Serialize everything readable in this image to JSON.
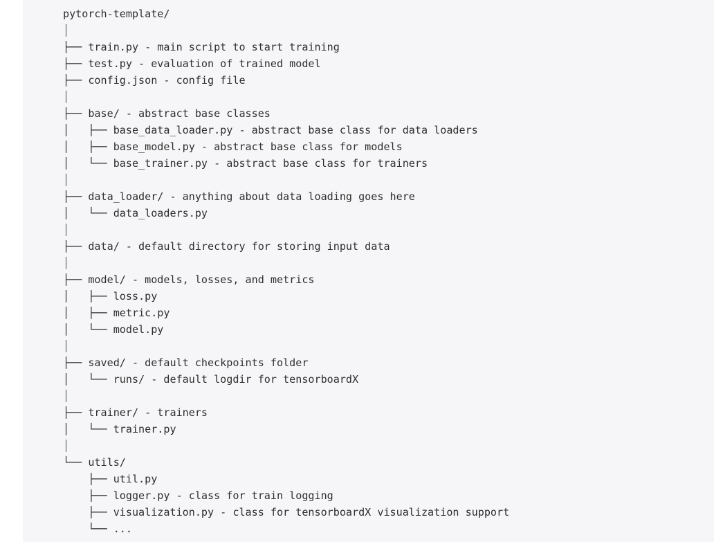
{
  "document": {
    "kind": "directory-tree-listing",
    "root_label": "pytorch-template/",
    "colors": {
      "page_background": "#ffffff",
      "content_background": "#f6f6f8",
      "text": "#2e2e2e",
      "tree_rule": "#5a6a65"
    },
    "lines": [
      "pytorch-template/",
      "│",
      "├── train.py - main script to start training",
      "├── test.py - evaluation of trained model",
      "├── config.json - config file",
      "│",
      "├── base/ - abstract base classes",
      "│   ├── base_data_loader.py - abstract base class for data loaders",
      "│   ├── base_model.py - abstract base class for models",
      "│   └── base_trainer.py - abstract base class for trainers",
      "│",
      "├── data_loader/ - anything about data loading goes here",
      "│   └── data_loaders.py",
      "│",
      "├── data/ - default directory for storing input data",
      "│",
      "├── model/ - models, losses, and metrics",
      "│   ├── loss.py",
      "│   ├── metric.py",
      "│   └── model.py",
      "│",
      "├── saved/ - default checkpoints folder",
      "│   └── runs/ - default logdir for tensorboardX",
      "│",
      "├── trainer/ - trainers",
      "│   └── trainer.py",
      "│",
      "└── utils/",
      "    ├── util.py",
      "    ├── logger.py - class for train logging",
      "    ├── visualization.py - class for tensorboardX visualization support",
      "    └── ..."
    ],
    "entries": [
      {
        "name": "pytorch-template/",
        "type": "directory",
        "depth": 0,
        "description": ""
      },
      {
        "name": "train.py",
        "type": "file",
        "depth": 1,
        "description": "main script to start training"
      },
      {
        "name": "test.py",
        "type": "file",
        "depth": 1,
        "description": "evaluation of trained model"
      },
      {
        "name": "config.json",
        "type": "file",
        "depth": 1,
        "description": "config file"
      },
      {
        "name": "base/",
        "type": "directory",
        "depth": 1,
        "description": "abstract base classes"
      },
      {
        "name": "base_data_loader.py",
        "type": "file",
        "depth": 2,
        "description": "abstract base class for data loaders"
      },
      {
        "name": "base_model.py",
        "type": "file",
        "depth": 2,
        "description": "abstract base class for models"
      },
      {
        "name": "base_trainer.py",
        "type": "file",
        "depth": 2,
        "description": "abstract base class for trainers"
      },
      {
        "name": "data_loader/",
        "type": "directory",
        "depth": 1,
        "description": "anything about data loading goes here"
      },
      {
        "name": "data_loaders.py",
        "type": "file",
        "depth": 2,
        "description": ""
      },
      {
        "name": "data/",
        "type": "directory",
        "depth": 1,
        "description": "default directory for storing input data"
      },
      {
        "name": "model/",
        "type": "directory",
        "depth": 1,
        "description": "models, losses, and metrics"
      },
      {
        "name": "loss.py",
        "type": "file",
        "depth": 2,
        "description": ""
      },
      {
        "name": "metric.py",
        "type": "file",
        "depth": 2,
        "description": ""
      },
      {
        "name": "model.py",
        "type": "file",
        "depth": 2,
        "description": ""
      },
      {
        "name": "saved/",
        "type": "directory",
        "depth": 1,
        "description": "default checkpoints folder"
      },
      {
        "name": "runs/",
        "type": "directory",
        "depth": 2,
        "description": "default logdir for tensorboardX"
      },
      {
        "name": "trainer/",
        "type": "directory",
        "depth": 1,
        "description": "trainers"
      },
      {
        "name": "trainer.py",
        "type": "file",
        "depth": 2,
        "description": ""
      },
      {
        "name": "utils/",
        "type": "directory",
        "depth": 1,
        "description": ""
      },
      {
        "name": "util.py",
        "type": "file",
        "depth": 2,
        "description": ""
      },
      {
        "name": "logger.py",
        "type": "file",
        "depth": 2,
        "description": "class for train logging"
      },
      {
        "name": "visualization.py",
        "type": "file",
        "depth": 2,
        "description": "class for tensorboardX visualization support"
      },
      {
        "name": "...",
        "type": "ellipsis",
        "depth": 2,
        "description": ""
      }
    ]
  }
}
